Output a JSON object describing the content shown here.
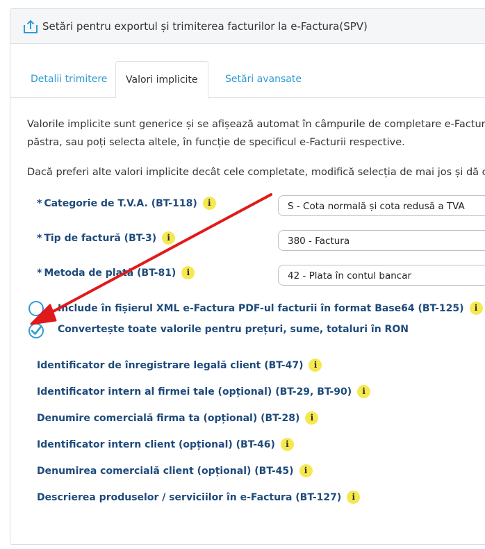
{
  "header": {
    "title": "Setări pentru exportul și trimiterea facturilor la e-Factura(SPV)",
    "icon": "upload-icon"
  },
  "tabs": [
    {
      "label": "Detalii trimitere",
      "active": false
    },
    {
      "label": "Valori implicite",
      "active": true
    },
    {
      "label": "Setări avansate",
      "active": false
    }
  ],
  "intro": {
    "line1": "Valorile implicite sunt generice și se afișează automat în câmpurile de completare e-Factura. D",
    "line2": "păstra, sau poți selecta altele, în funcție de specificul e-Facturii respective.",
    "line3": "Dacă preferi alte valori implicite decât cele completate, modifică selecția de mai jos și dă click"
  },
  "fields": [
    {
      "required_mark": "*",
      "label": "Categorie de T.V.A. (BT-118)",
      "value": "S - Cota normală și cota redusă a TVA"
    },
    {
      "required_mark": "*",
      "label": "Tip de factură (BT-3)",
      "value": "380 - Factura"
    },
    {
      "required_mark": "*",
      "label": "Metoda de plată (BT-81)",
      "value": "42 - Plata în contul bancar"
    }
  ],
  "options": [
    {
      "label": "Include în fișierul XML e-Factura PDF-ul facturii în format Base64 (BT-125)",
      "checked": false
    },
    {
      "label": "Convertește toate valorile pentru prețuri, sume, totaluri în RON",
      "checked": true
    }
  ],
  "links": [
    "Identificator de înregistrare legală client (BT-47)",
    "Identificator intern al firmei tale (opțional) (BT-29, BT-90)",
    "Denumire comercială firma ta (opțional) (BT-28)",
    "Identificator intern client (opțional) (BT-46)",
    "Denumirea comercială client (opțional) (BT-45)",
    "Descrierea produselor / serviciilor în e-Factura (BT-127)"
  ],
  "info_glyph": "i",
  "colors": {
    "accent": "#2f9bd4",
    "label": "#1e4a7c",
    "info_badge": "#f6e84f",
    "arrow": "#e01a1a"
  }
}
